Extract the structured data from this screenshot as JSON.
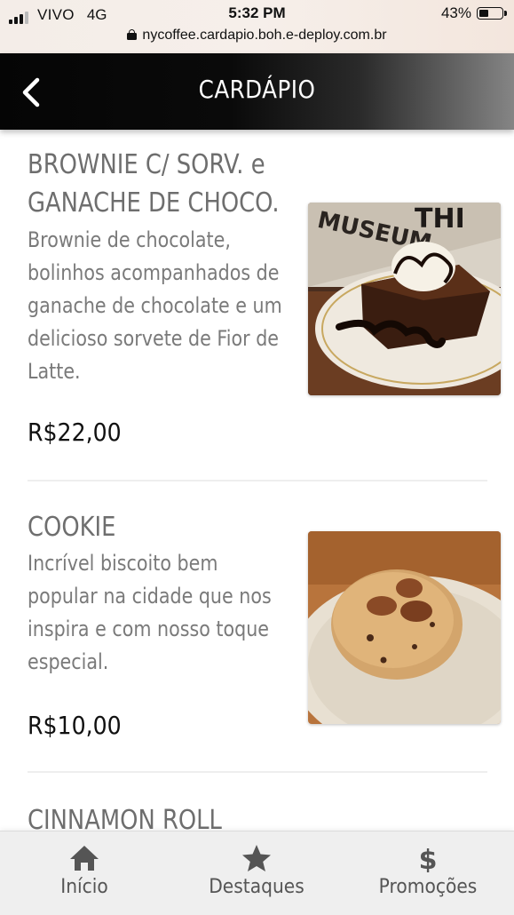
{
  "status_bar": {
    "carrier": "VIVO",
    "network": "4G",
    "time": "5:32 PM",
    "battery": "43%",
    "url": "nycoffee.cardapio.boh.e-deploy.com.br"
  },
  "header": {
    "title": "CARDÁPIO",
    "back_icon": "chevron-left-icon"
  },
  "menu": {
    "items": [
      {
        "name": "BROWNIE C/ SORV. e GANACHE DE CHOCO.",
        "name_lines": [
          "BROWNIE C/ SORV. e",
          "GANACHE DE CHOCO."
        ],
        "description": "Brownie de chocolate, bolinhos acompanhados de ganache de chocolate e um delicioso sorvete de Fior de Latte.",
        "description_lines": [
          "Brownie de chocolate,",
          "bolinhos acompanhados de",
          "ganache de chocolate e um",
          "delicioso sorvete de Fior de",
          "Latte."
        ],
        "price": "R$22,00"
      },
      {
        "name": "COOKIE",
        "description": "Incrível biscoito bem popular na cidade que nos inspira e com nosso toque especial.",
        "description_lines": [
          "Incrível biscoito bem",
          "popular na cidade que nos",
          "inspira e com nosso toque",
          "especial."
        ],
        "price": "R$10,00"
      },
      {
        "name": "CINNAMON ROLL"
      }
    ]
  },
  "bottom_nav": {
    "items": [
      {
        "label": "Início",
        "icon": "home-icon"
      },
      {
        "label": "Destaques",
        "icon": "star-icon"
      },
      {
        "label": "Promoções",
        "icon": "dollar-icon"
      }
    ]
  },
  "colors": {
    "header_bg": "#050505",
    "title_text": "#6e6e6e",
    "description_text": "#7a7a7a",
    "price_text": "#111111",
    "bottom_nav_bg": "#efefef"
  }
}
